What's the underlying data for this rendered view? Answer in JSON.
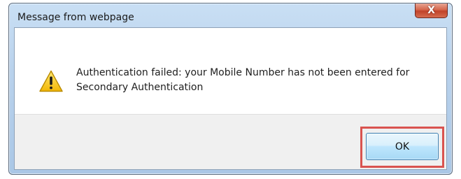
{
  "window": {
    "title": "Message from webpage",
    "close_label": "X"
  },
  "message": {
    "icon": "warning-icon",
    "text": "Authentication failed: your Mobile Number has not been entered for Secondary Authentication"
  },
  "buttons": {
    "ok_label": "OK"
  },
  "colors": {
    "highlight": "#d9534f",
    "close_button": "#c0432a",
    "warning_yellow": "#f5c518"
  }
}
